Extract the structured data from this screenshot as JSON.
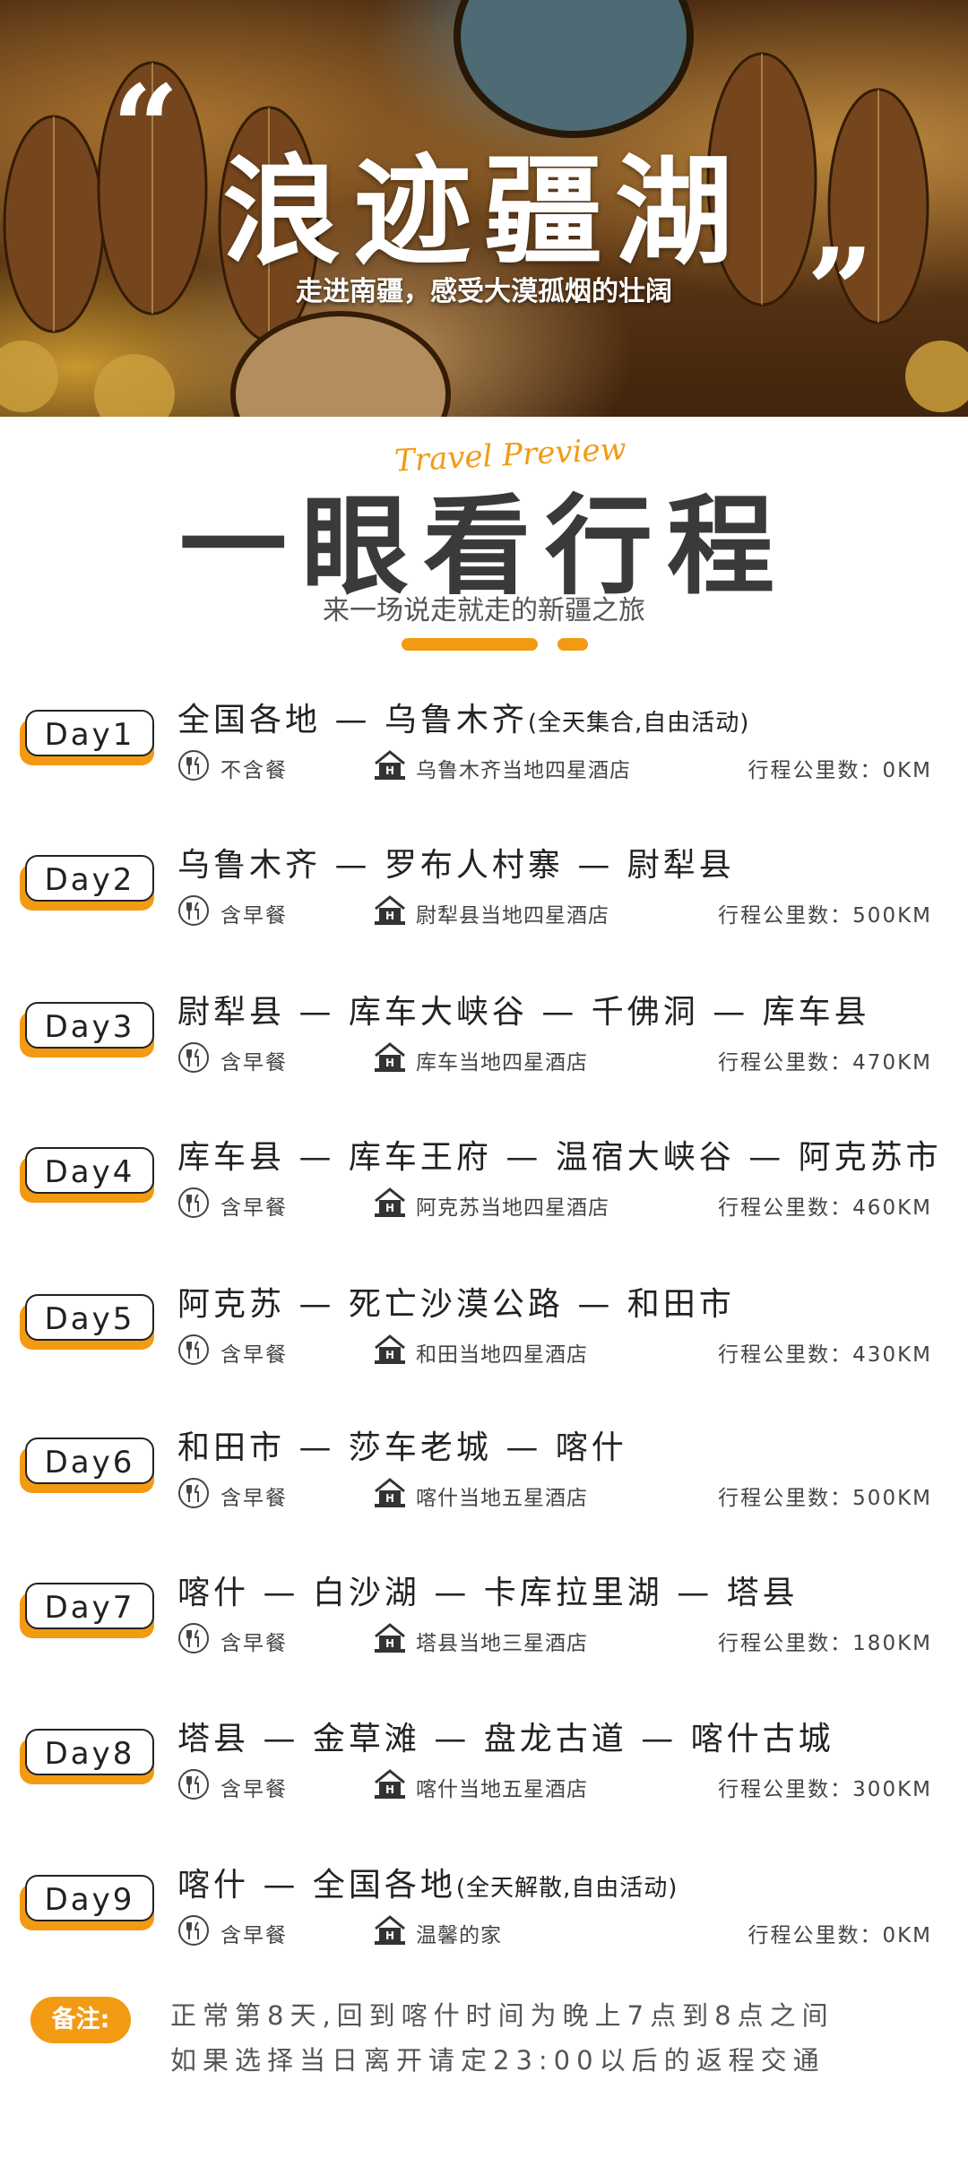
{
  "hero": {
    "title": "浪迹疆湖",
    "subtitle": "走进南疆，感受大漠孤烟的壮阔",
    "quote_open": "“",
    "quote_close": "”"
  },
  "section": {
    "script": "Travel Preview",
    "title": "一眼看行程",
    "subtitle": "来一场说走就走的新疆之旅"
  },
  "days": [
    {
      "label": "Day1",
      "route": "全国各地 — 乌鲁木齐",
      "note": "(全天集合,自由活动)",
      "meal": "不含餐",
      "hotel": "乌鲁木齐当地四星酒店",
      "km": "行程公里数：0KM"
    },
    {
      "label": "Day2",
      "route": "乌鲁木齐 — 罗布人村寨 — 尉犁县",
      "note": "",
      "meal": "含早餐",
      "hotel": "尉犁县当地四星酒店",
      "km": "行程公里数：500KM"
    },
    {
      "label": "Day3",
      "route": "尉犁县 — 库车大峡谷 — 千佛洞 — 库车县",
      "note": "",
      "meal": "含早餐",
      "hotel": "库车当地四星酒店",
      "km": "行程公里数：470KM"
    },
    {
      "label": "Day4",
      "route": "库车县 — 库车王府 — 温宿大峡谷 — 阿克苏市",
      "note": "",
      "meal": "含早餐",
      "hotel": "阿克苏当地四星酒店",
      "km": "行程公里数：460KM"
    },
    {
      "label": "Day5",
      "route": "阿克苏 — 死亡沙漠公路 — 和田市",
      "note": "",
      "meal": "含早餐",
      "hotel": "和田当地四星酒店",
      "km": "行程公里数：430KM"
    },
    {
      "label": "Day6",
      "route": "和田市 — 莎车老城 — 喀什",
      "note": "",
      "meal": "含早餐",
      "hotel": "喀什当地五星酒店",
      "km": "行程公里数：500KM"
    },
    {
      "label": "Day7",
      "route": "喀什 — 白沙湖 — 卡库拉里湖 — 塔县",
      "note": "",
      "meal": "含早餐",
      "hotel": "塔县当地三星酒店",
      "km": "行程公里数：180KM"
    },
    {
      "label": "Day8",
      "route": "塔县 — 金草滩 — 盘龙古道 — 喀什古城",
      "note": "",
      "meal": "含早餐",
      "hotel": "喀什当地五星酒店",
      "km": "行程公里数：300KM"
    },
    {
      "label": "Day9",
      "route": "喀什 — 全国各地",
      "note": "(全天解散,自由活动)",
      "meal": "含早餐",
      "hotel": "温馨的家",
      "km": "行程公里数：0KM"
    }
  ],
  "remark": {
    "label": "备注:",
    "line1": "正常第8天,回到喀什时间为晚上7点到8点之间",
    "line2": "如果选择当日离开请定23:00以后的返程交通"
  },
  "colors": {
    "accent": "#f39a13",
    "text": "#222222"
  },
  "icons": [
    "fork-knife-icon",
    "hotel-icon"
  ]
}
